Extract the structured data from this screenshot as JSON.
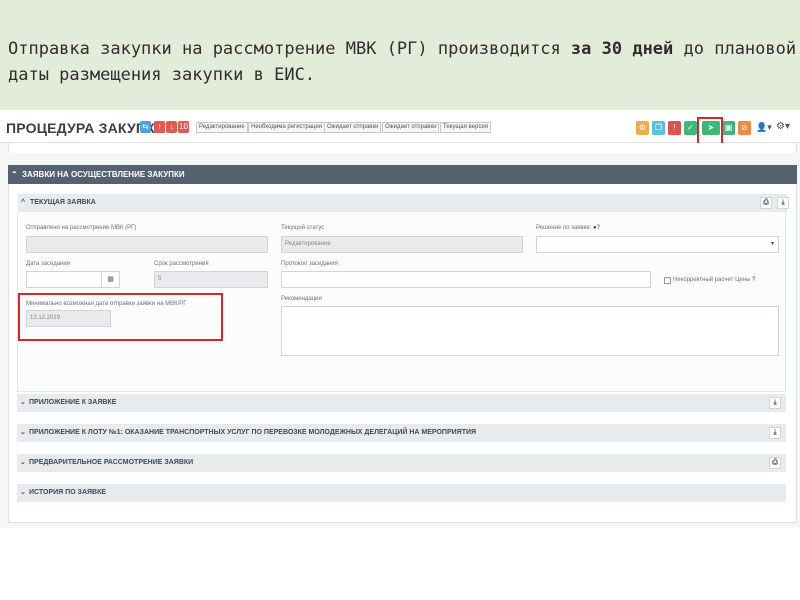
{
  "slide": {
    "text_before": "Отправка закупки на рассмотрение МВК (РГ) производится ",
    "text_bold": "за 30 дней",
    "text_after": " до плановой даты размещения закупки в ЕИС."
  },
  "toolbar": {
    "title": "ПРОЦЕДУРА ЗАКУПКИ",
    "mini": [
      {
        "name": "share-icon",
        "glyph": "⇆",
        "color": "#4aa3df"
      },
      {
        "name": "arrow-up-icon",
        "glyph": "↑",
        "color": "#e05b4d"
      },
      {
        "name": "arrow-down-icon",
        "glyph": "↓",
        "color": "#e05b4d"
      },
      {
        "name": "counter-badge",
        "glyph": "10",
        "color": "#e05b4d"
      }
    ],
    "tags": [
      "Редактирование",
      "Необходима регистрация",
      "Ожидает отправки",
      "Ожидает отправки",
      "Текущая версия"
    ],
    "actions": [
      {
        "name": "gear-icon",
        "glyph": "⚙",
        "color": "#f0ad4e"
      },
      {
        "name": "copy-icon",
        "glyph": "❐",
        "color": "#5bc0de"
      },
      {
        "name": "alert-icon",
        "glyph": "!",
        "color": "#d9534f"
      },
      {
        "name": "check-icon",
        "glyph": "✓",
        "color": "#3cb878"
      },
      {
        "name": "send-icon",
        "glyph": "➤",
        "color": "#3cb878"
      },
      {
        "name": "document-icon",
        "glyph": "▣",
        "color": "#3cb878"
      },
      {
        "name": "block-icon",
        "glyph": "⊘",
        "color": "#f0883e"
      }
    ],
    "user_glyph": "👤▾",
    "settings_glyph": "⚙▾"
  },
  "section": {
    "title": "ЗАЯВКИ НА ОСУЩЕСТВЛЕНИЕ ЗАКУПКИ",
    "current": {
      "title": "ТЕКУЩАЯ ЗАЯВКА",
      "sent_label": "Отправлено на рассмотрение МВК (РГ)",
      "sent_value": "",
      "status_label": "Текущий статус",
      "status_value": "Редактирование",
      "decision_label": "Решение по заявке:",
      "decision_value": "",
      "meeting_date_label": "Дата заседания",
      "meeting_date_value": "",
      "review_term_label": "Срок рассмотрения",
      "review_term_value": "5",
      "protocol_label": "Протокол заседания",
      "protocol_value": "",
      "incorrect_calc_label": "Некорректный расчет Цены",
      "min_date_label": "Минимально возможная дата отправки заявки на МВК/РГ",
      "min_date_value": "13.12.2019",
      "recommendations_label": "Рекомендации"
    },
    "subsections": [
      {
        "title": "ПРИЛОЖЕНИЕ К ЗАЯВКЕ"
      },
      {
        "title": "ПРИЛОЖЕНИЕ К ЛОТУ №1: ОКАЗАНИЕ ТРАНСПОРТНЫХ УСЛУГ ПО ПЕРЕВОЗКЕ МОЛОДЕЖНЫХ ДЕЛЕГАЦИЙ НА МЕРОПРИЯТИЯ"
      },
      {
        "title": "ПРЕДВАРИТЕЛЬНОЕ РАССМОТРЕНИЕ ЗАЯВКИ"
      },
      {
        "title": "ИСТОРИЯ ПО ЗАЯВКЕ"
      }
    ]
  },
  "colors": {
    "highlight": "#d9262c",
    "section_header": "#546270",
    "banner": "#e3ebd9"
  }
}
